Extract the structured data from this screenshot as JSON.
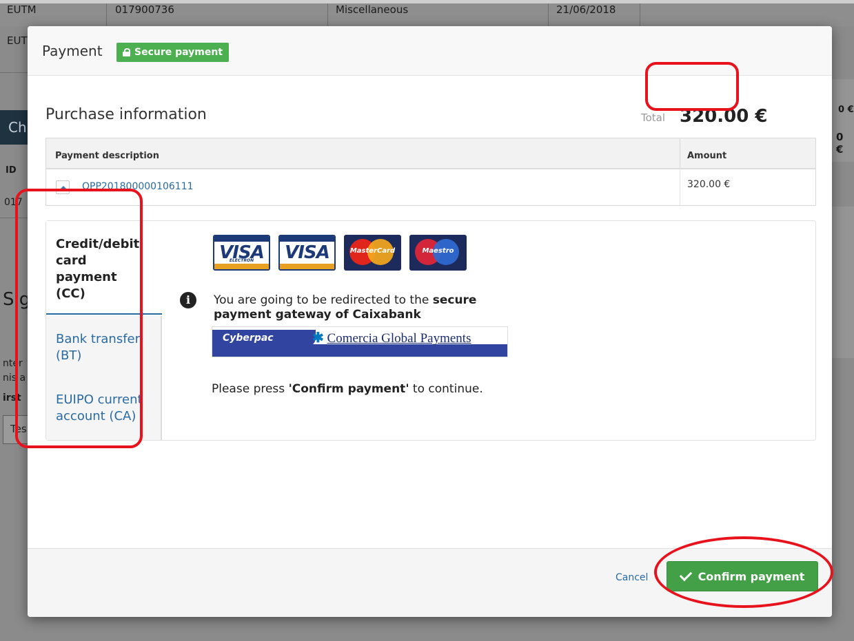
{
  "background": {
    "row1": [
      "EUTM",
      "017900736",
      "Miscellaneous",
      "21/06/2018"
    ],
    "row2_left": "EUT",
    "dark_bar_text": "Ch",
    "id_label": "ID",
    "id_partial": "017",
    "sig_heading": "Sig",
    "fragments": [
      "nter",
      "nis a",
      "irst"
    ],
    "input_partial": "Tes",
    "right_edge": [
      "0 €",
      "0 €"
    ]
  },
  "modal": {
    "title": "Payment",
    "secure_badge": "Secure payment",
    "section_title": "Purchase information",
    "total_label": "Total",
    "total_value": "320.00 €",
    "table": {
      "headers": [
        "Payment description",
        "Amount"
      ],
      "rows": [
        {
          "description": "OPP201800000106111",
          "amount": "320.00 €"
        }
      ]
    },
    "tabs": [
      {
        "label": "Credit/debit card payment (CC)",
        "lines": [
          "Credit/debit",
          "card",
          "payment",
          "(CC)"
        ],
        "active": true
      },
      {
        "label": "Bank transfer (BT)",
        "lines": [
          "Bank transfer",
          "(BT)"
        ],
        "active": false
      },
      {
        "label": "EUIPO current account (CA)",
        "lines": [
          "EUIPO current",
          "account (CA)"
        ],
        "active": false
      }
    ],
    "cards": [
      {
        "name": "visa-electron",
        "text": "VISA",
        "sub": "ELECTRON"
      },
      {
        "name": "visa",
        "text": "VISA"
      },
      {
        "name": "mastercard",
        "text": "MasterCard"
      },
      {
        "name": "maestro",
        "text": "Maestro"
      }
    ],
    "redirect": {
      "prefix": "You are going to be redirected to the ",
      "bold": "secure payment gateway of Caixabank"
    },
    "gateway": {
      "left": "Cyberpac",
      "right": "Comercia Global Payments"
    },
    "press": {
      "prefix": "Please press ",
      "bold": "'Confirm payment'",
      "suffix": " to continue."
    },
    "footer": {
      "cancel": "Cancel",
      "confirm": "Confirm payment"
    }
  },
  "colors": {
    "accent": "#2a6aa3",
    "success": "#43a047",
    "annotation": "#e8121c"
  }
}
